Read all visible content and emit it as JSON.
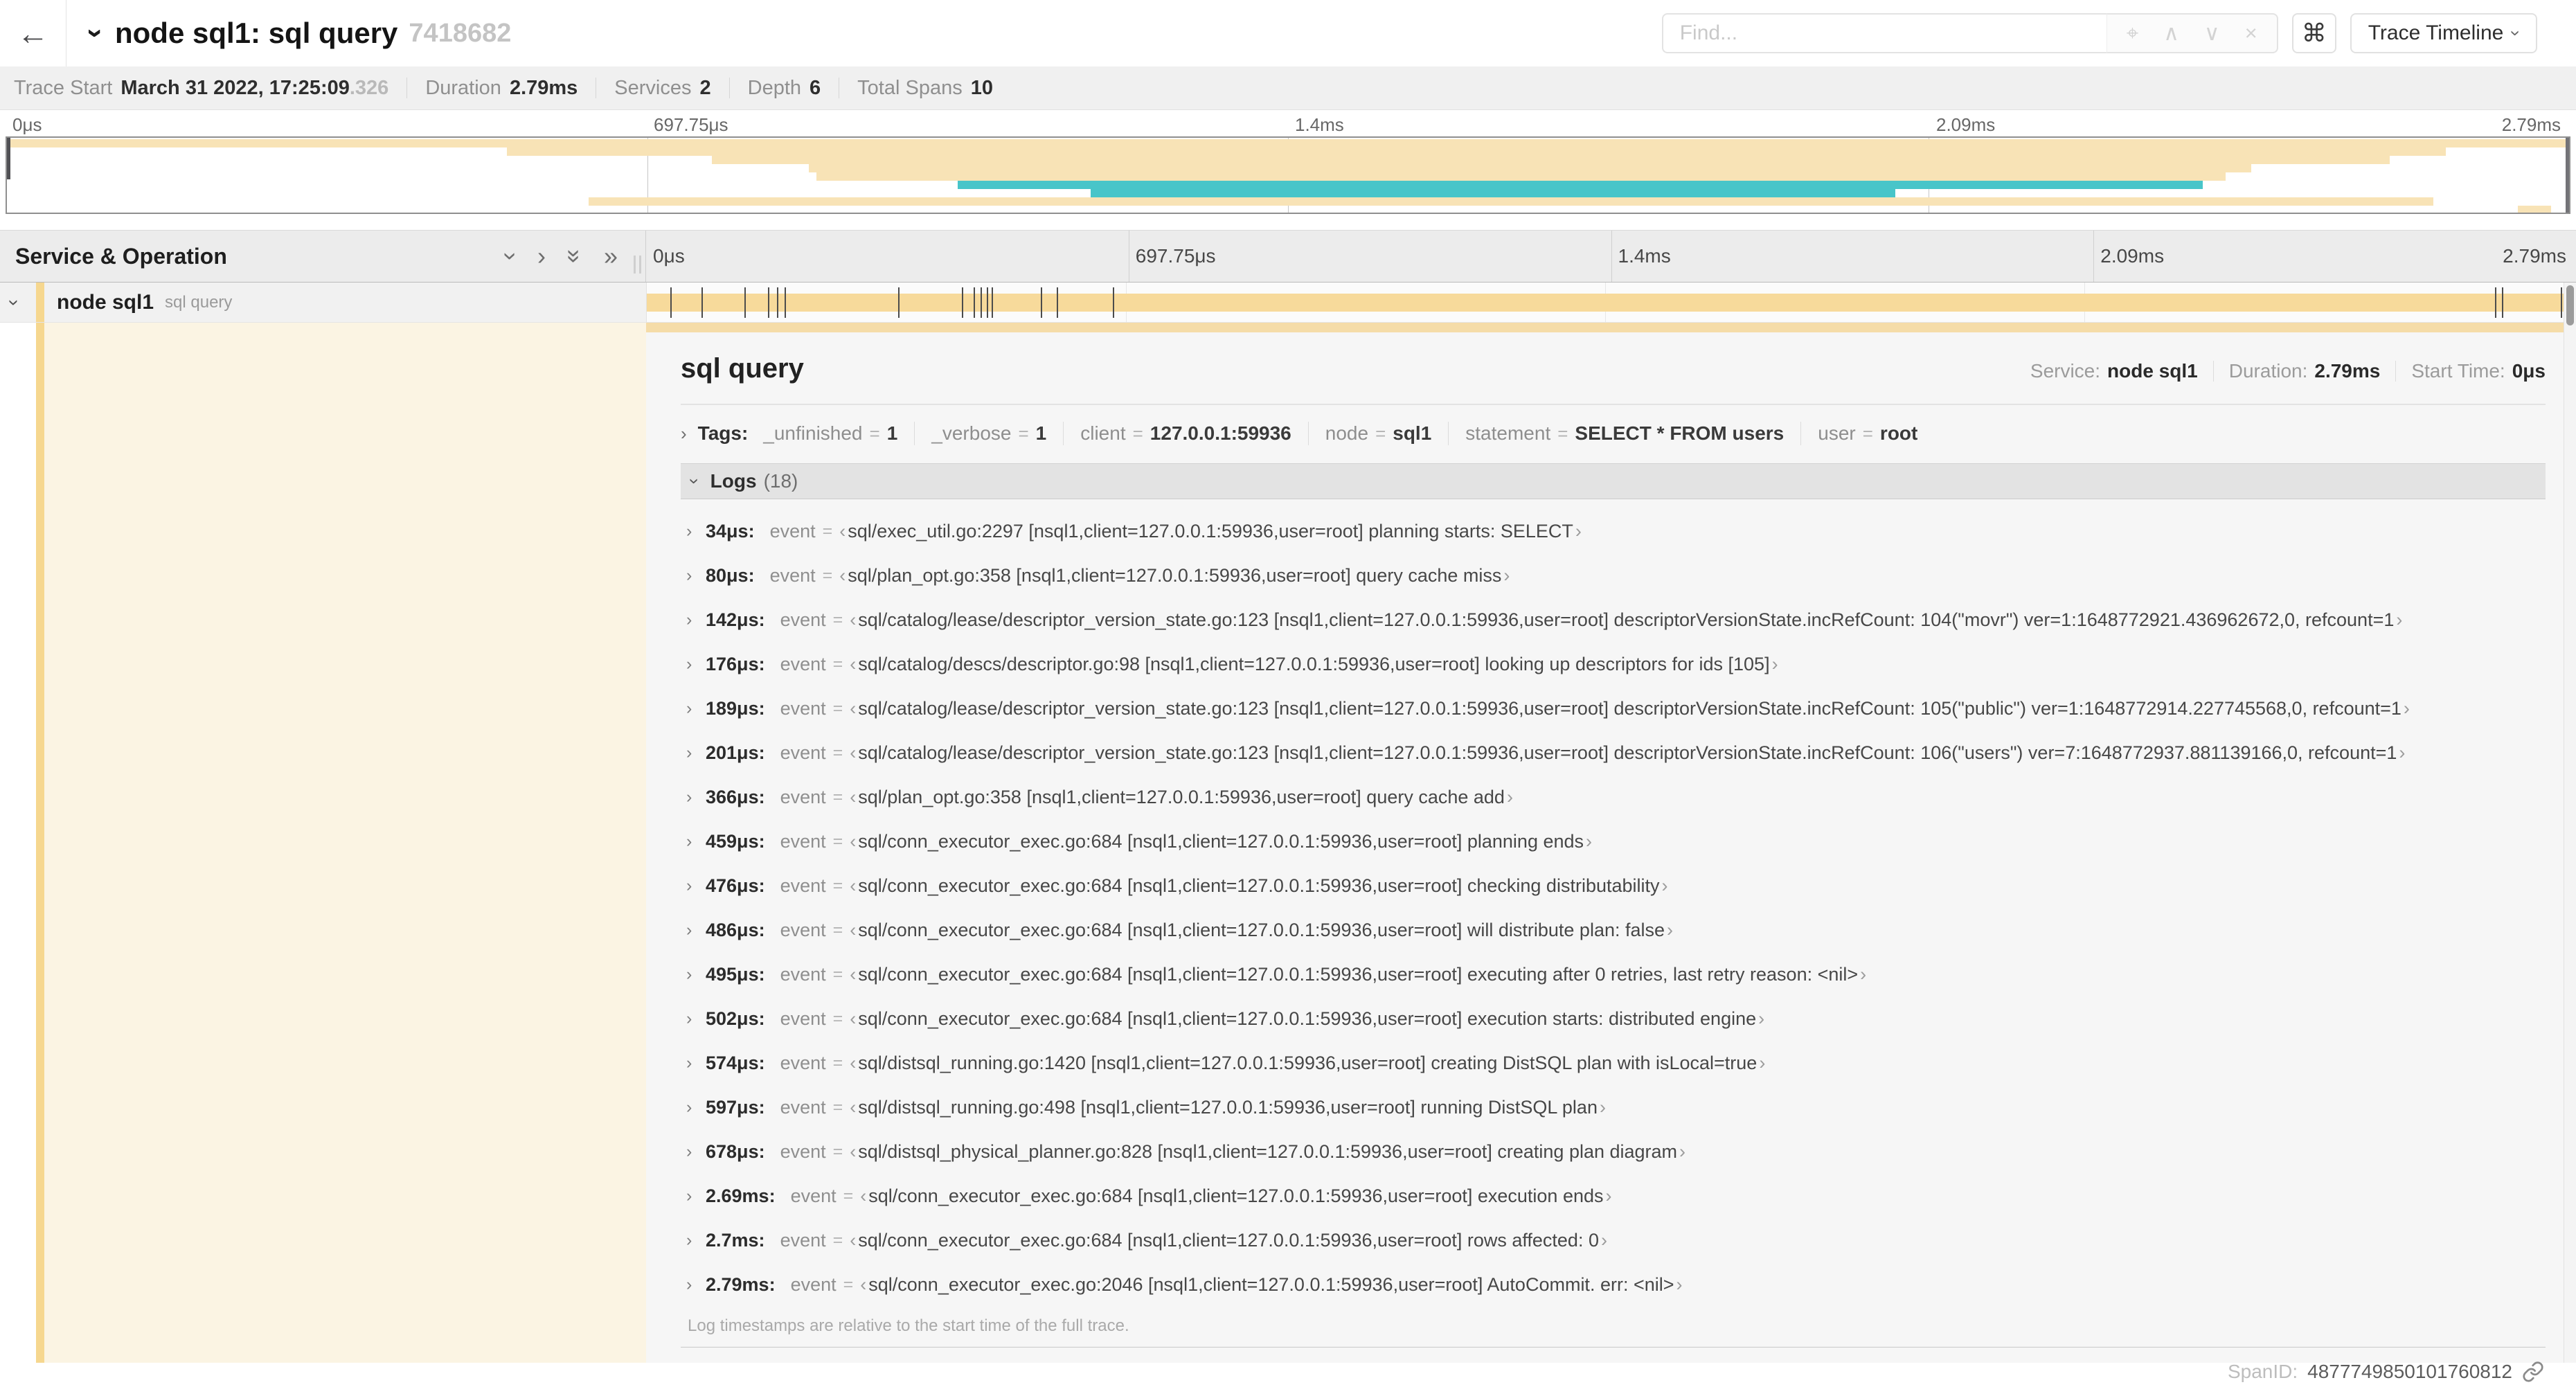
{
  "icons": {
    "back": "←",
    "chevron_right": "›",
    "dbl_chevron_right": "»",
    "locate": "⌖",
    "prev": "∧",
    "next": "∨",
    "clear": "×",
    "shortcut": "⌘"
  },
  "colors": {
    "span_tan": "#F7DA9B",
    "span_tan_light": "#F8E3B6",
    "span_teal": "#48C5C9",
    "accent_stripe": "#F6D78F",
    "selected_row_bg": "#FBF4E3",
    "detail_topbar": "#F5DCA8"
  },
  "header": {
    "title": "node sql1: sql query",
    "trace_id": "7418682",
    "find_placeholder": "Find...",
    "view_dropdown_label": "Trace Timeline"
  },
  "summary": {
    "items": [
      {
        "label": "Trace Start",
        "value": "March 31 2022, 17:25:09",
        "suffix": ".326"
      },
      {
        "label": "Duration",
        "value": "2.79ms",
        "suffix": ""
      },
      {
        "label": "Services",
        "value": "2",
        "suffix": ""
      },
      {
        "label": "Depth",
        "value": "6",
        "suffix": ""
      },
      {
        "label": "Total Spans",
        "value": "10",
        "suffix": ""
      }
    ]
  },
  "timeline": {
    "ticks": [
      {
        "label": "0μs",
        "pos": 0
      },
      {
        "label": "697.75μs",
        "pos": 25
      },
      {
        "label": "1.4ms",
        "pos": 50
      },
      {
        "label": "2.09ms",
        "pos": 75
      },
      {
        "label": "2.79ms",
        "pos": 100
      }
    ],
    "total_us": 2790
  },
  "minimap": {
    "spans": [
      {
        "start": 0,
        "end": 100,
        "color": "span_tan_light"
      },
      {
        "start": 19.5,
        "end": 95.2,
        "color": "span_tan_light"
      },
      {
        "start": 27.5,
        "end": 93.0,
        "color": "span_tan_light"
      },
      {
        "start": 31.3,
        "end": 87.6,
        "color": "span_tan_light"
      },
      {
        "start": 31.6,
        "end": 86.6,
        "color": "span_tan_light"
      },
      {
        "start": 37.1,
        "end": 85.7,
        "color": "span_teal"
      },
      {
        "start": 42.3,
        "end": 73.7,
        "color": "span_teal"
      },
      {
        "start": 22.7,
        "end": 94.7,
        "color": "span_tan_light"
      },
      {
        "start": 98.0,
        "end": 99.3,
        "color": "span_tan_light"
      }
    ]
  },
  "tree": {
    "columns_header": "Service & Operation",
    "row": {
      "service": "node sql1",
      "operation": "sql query"
    }
  },
  "detail": {
    "title": "sql query",
    "meta": [
      {
        "label": "Service:",
        "value": "node sql1"
      },
      {
        "label": "Duration:",
        "value": "2.79ms"
      },
      {
        "label": "Start Time:",
        "value": "0μs"
      }
    ],
    "tags_label": "Tags:",
    "tags": [
      {
        "key": "_unfinished",
        "value": "1"
      },
      {
        "key": "_verbose",
        "value": "1"
      },
      {
        "key": "client",
        "value": "127.0.0.1:59936"
      },
      {
        "key": "node",
        "value": "sql1"
      },
      {
        "key": "statement",
        "value": "SELECT * FROM users"
      },
      {
        "key": "user",
        "value": "root"
      }
    ],
    "logs_label": "Logs",
    "logs_count": "(18)",
    "log_times_us": [
      34,
      80,
      142,
      176,
      189,
      201,
      366,
      459,
      476,
      486,
      495,
      502,
      574,
      597,
      678,
      2690,
      2700,
      2790
    ],
    "logs": [
      {
        "time": "34μs:",
        "field": "event",
        "value": "sql/exec_util.go:2297 [nsql1,client=127.0.0.1:59936,user=root] planning starts: SELECT"
      },
      {
        "time": "80μs:",
        "field": "event",
        "value": "sql/plan_opt.go:358 [nsql1,client=127.0.0.1:59936,user=root] query cache miss"
      },
      {
        "time": "142μs:",
        "field": "event",
        "value": "sql/catalog/lease/descriptor_version_state.go:123 [nsql1,client=127.0.0.1:59936,user=root] descriptorVersionState.incRefCount: 104(\"movr\") ver=1:1648772921.436962672,0, refcount=1"
      },
      {
        "time": "176μs:",
        "field": "event",
        "value": "sql/catalog/descs/descriptor.go:98 [nsql1,client=127.0.0.1:59936,user=root] looking up descriptors for ids [105]"
      },
      {
        "time": "189μs:",
        "field": "event",
        "value": "sql/catalog/lease/descriptor_version_state.go:123 [nsql1,client=127.0.0.1:59936,user=root] descriptorVersionState.incRefCount: 105(\"public\") ver=1:1648772914.227745568,0, refcount=1"
      },
      {
        "time": "201μs:",
        "field": "event",
        "value": "sql/catalog/lease/descriptor_version_state.go:123 [nsql1,client=127.0.0.1:59936,user=root] descriptorVersionState.incRefCount: 106(\"users\") ver=7:1648772937.881139166,0, refcount=1"
      },
      {
        "time": "366μs:",
        "field": "event",
        "value": "sql/plan_opt.go:358 [nsql1,client=127.0.0.1:59936,user=root] query cache add"
      },
      {
        "time": "459μs:",
        "field": "event",
        "value": "sql/conn_executor_exec.go:684 [nsql1,client=127.0.0.1:59936,user=root] planning ends"
      },
      {
        "time": "476μs:",
        "field": "event",
        "value": "sql/conn_executor_exec.go:684 [nsql1,client=127.0.0.1:59936,user=root] checking distributability"
      },
      {
        "time": "486μs:",
        "field": "event",
        "value": "sql/conn_executor_exec.go:684 [nsql1,client=127.0.0.1:59936,user=root] will distribute plan: false"
      },
      {
        "time": "495μs:",
        "field": "event",
        "value": "sql/conn_executor_exec.go:684 [nsql1,client=127.0.0.1:59936,user=root] executing after 0 retries, last retry reason: <nil>"
      },
      {
        "time": "502μs:",
        "field": "event",
        "value": "sql/conn_executor_exec.go:684 [nsql1,client=127.0.0.1:59936,user=root] execution starts: distributed engine"
      },
      {
        "time": "574μs:",
        "field": "event",
        "value": "sql/distsql_running.go:1420 [nsql1,client=127.0.0.1:59936,user=root] creating DistSQL plan with isLocal=true"
      },
      {
        "time": "597μs:",
        "field": "event",
        "value": "sql/distsql_running.go:498 [nsql1,client=127.0.0.1:59936,user=root] running DistSQL plan"
      },
      {
        "time": "678μs:",
        "field": "event",
        "value": "sql/distsql_physical_planner.go:828 [nsql1,client=127.0.0.1:59936,user=root] creating plan diagram"
      },
      {
        "time": "2.69ms:",
        "field": "event",
        "value": "sql/conn_executor_exec.go:684 [nsql1,client=127.0.0.1:59936,user=root] execution ends"
      },
      {
        "time": "2.7ms:",
        "field": "event",
        "value": "sql/conn_executor_exec.go:684 [nsql1,client=127.0.0.1:59936,user=root] rows affected: 0"
      },
      {
        "time": "2.79ms:",
        "field": "event",
        "value": "sql/conn_executor_exec.go:2046 [nsql1,client=127.0.0.1:59936,user=root] AutoCommit. err: <nil>"
      }
    ],
    "logs_footer": "Log timestamps are relative to the start time of the full trace.",
    "span_id_label": "SpanID:",
    "span_id": "4877749850101760812"
  }
}
